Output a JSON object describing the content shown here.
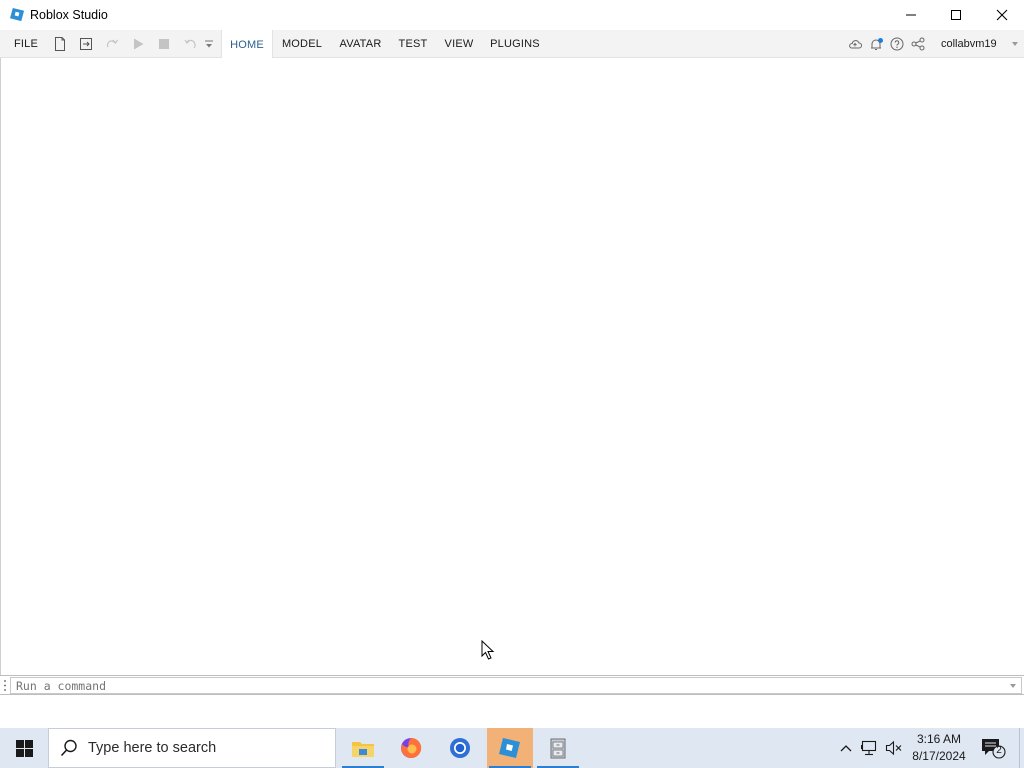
{
  "window": {
    "title": "Roblox Studio"
  },
  "ribbon": {
    "file_label": "FILE",
    "tabs": [
      {
        "label": "HOME",
        "active": true
      },
      {
        "label": "MODEL",
        "active": false
      },
      {
        "label": "AVATAR",
        "active": false
      },
      {
        "label": "TEST",
        "active": false
      },
      {
        "label": "VIEW",
        "active": false
      },
      {
        "label": "PLUGINS",
        "active": false
      }
    ],
    "username": "collabvm19",
    "accent_color": "#2b5f8f",
    "quick_tools": [
      "new-file-icon",
      "publish-icon",
      "redo-icon",
      "play-icon",
      "stop-icon",
      "undo-icon",
      "customize-icon"
    ],
    "right_tools": [
      "cloud-icon",
      "notification-icon",
      "help-icon",
      "share-icon"
    ]
  },
  "command_bar": {
    "placeholder": "Run a command"
  },
  "taskbar": {
    "search_placeholder": "Type here to search",
    "apps": [
      "file-explorer-icon",
      "firefox-icon",
      "chrome-icon",
      "roblox-studio-icon",
      "file-cabinet-icon"
    ],
    "active_app": "roblox-studio-icon",
    "clock_time": "3:16 AM",
    "clock_date": "8/17/2024",
    "notification_count": "2"
  }
}
